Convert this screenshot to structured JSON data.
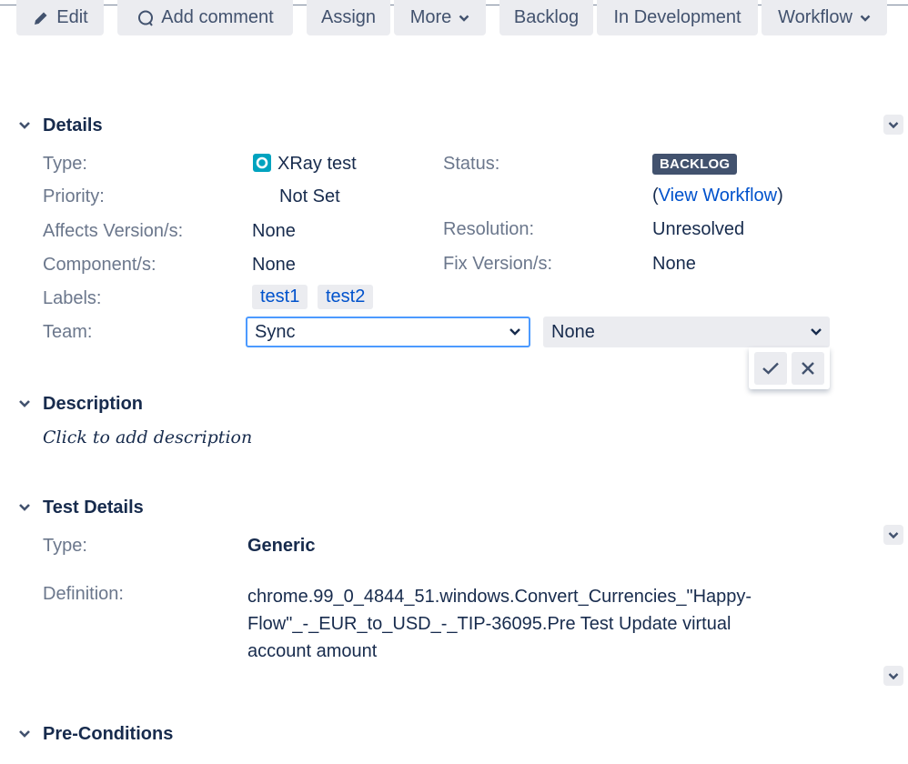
{
  "toolbar": {
    "edit": "Edit",
    "add_comment": "Add comment",
    "assign": "Assign",
    "more": "More",
    "backlog": "Backlog",
    "in_development": "In Development",
    "workflow": "Workflow"
  },
  "details": {
    "title": "Details",
    "type_label": "Type:",
    "type_value": "XRay test",
    "status_label": "Status:",
    "status_value": "BACKLOG",
    "view_workflow_open": "(",
    "view_workflow": "View Workflow",
    "view_workflow_close": ")",
    "priority_label": "Priority:",
    "priority_value": "Not Set",
    "affects_label": "Affects Version/s:",
    "affects_value": "None",
    "resolution_label": "Resolution:",
    "resolution_value": "Unresolved",
    "component_label": "Component/s:",
    "component_value": "None",
    "fix_label": "Fix Version/s:",
    "fix_value": "None",
    "labels_label": "Labels:",
    "labels": [
      "test1",
      "test2"
    ],
    "team_label": "Team:",
    "team_select": "Sync",
    "team_select2": "None"
  },
  "description": {
    "title": "Description",
    "placeholder": "Click to add description"
  },
  "test_details": {
    "title": "Test Details",
    "type_label": "Type:",
    "type_value": "Generic",
    "definition_label": "Definition:",
    "definition_value": "chrome.99_0_4844_51.windows.Convert_Currencies_\"Happy-Flow\"_-_EUR_to_USD_-_TIP-36095.Pre Test Update virtual account amount"
  },
  "pre_conditions": {
    "title": "Pre-Conditions"
  },
  "colors": {
    "accent": "#0052cc",
    "focus_border": "#4c9aff",
    "lozenge": "#42526e",
    "xray_icon": "#00a3bf"
  },
  "icons": [
    "pencil-icon",
    "comment-icon",
    "chevron-down-icon",
    "xray-test-icon",
    "check-icon",
    "close-icon"
  ]
}
